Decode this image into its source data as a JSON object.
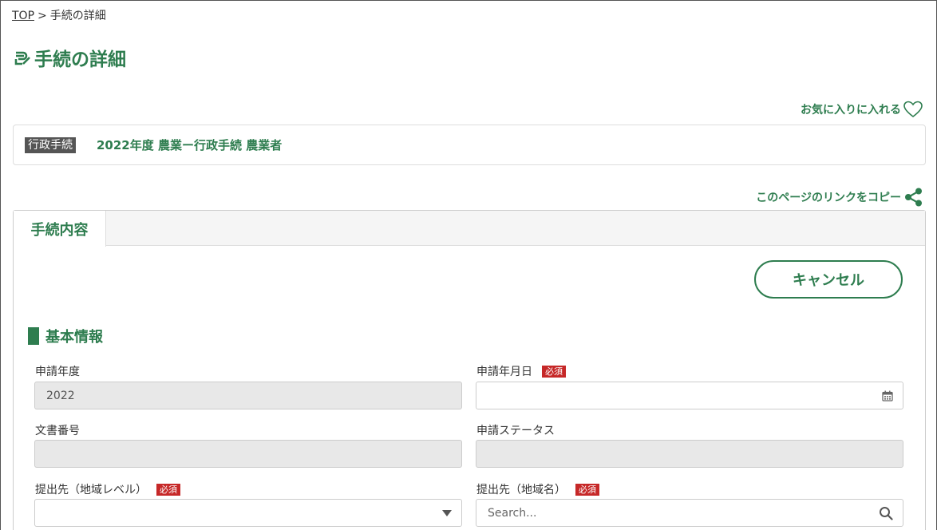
{
  "breadcrumb": {
    "top": "TOP",
    "separator": ">",
    "current": "手続の詳細"
  },
  "page_title": "手続の詳細",
  "favorite_label": "お気に入りに入れる",
  "info": {
    "badge": "行政手続",
    "title": "2022年度 農業ー行政手続 農業者"
  },
  "copy_link_label": "このページのリンクをコピー",
  "tabs": [
    {
      "label": "手続内容",
      "active": true
    }
  ],
  "cancel_label": "キャンセル",
  "section_title": "基本情報",
  "required_badge": "必須",
  "fields": {
    "application_year": {
      "label": "申請年度",
      "value": "2022"
    },
    "application_date": {
      "label": "申請年月日",
      "value": ""
    },
    "document_number": {
      "label": "文書番号",
      "value": ""
    },
    "application_status": {
      "label": "申請ステータス",
      "value": ""
    },
    "submit_region_level": {
      "label": "提出先（地域レベル）",
      "value": ""
    },
    "submit_region_name": {
      "label": "提出先（地域名）",
      "placeholder": "Search..."
    }
  },
  "colors": {
    "accent": "#2e7d4f",
    "required": "#c62828",
    "badge_gray": "#555555"
  },
  "icons": [
    "tag-icon",
    "heart-icon",
    "share-icon",
    "calendar-icon",
    "caret-down-icon",
    "search-icon"
  ]
}
